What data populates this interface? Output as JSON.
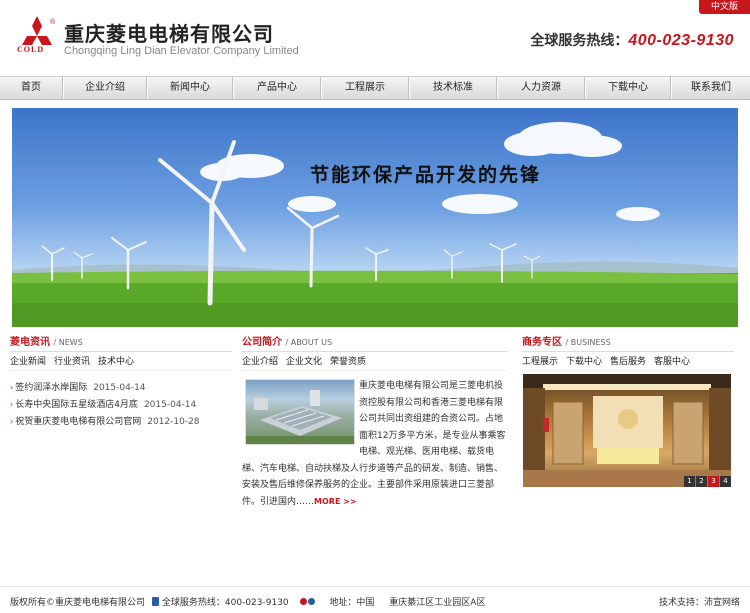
{
  "header": {
    "lang_badge": "中文版",
    "logo_word": "COLD",
    "company_cn": "重庆菱电电梯有限公司",
    "company_en": "Chongqing Ling Dian Elevator Company Limited",
    "hotline_label": "全球服务热线：",
    "hotline_number": "400-023-9130"
  },
  "nav": {
    "items": [
      "首页",
      "企业介绍",
      "新闻中心",
      "产品中心",
      "工程展示",
      "技术标准",
      "人力资源",
      "下载中心",
      "联系我们"
    ]
  },
  "banner": {
    "slogan": "节能环保产品开发的先锋"
  },
  "news": {
    "title": "菱电资讯",
    "subtitle": "/ NEWS",
    "tabs": [
      "企业新闻",
      "行业资讯",
      "技术中心"
    ],
    "items": [
      {
        "title": "签约润泽水岸国际",
        "date": "2015-04-14"
      },
      {
        "title": "长寿中央国际五星级酒店4月底",
        "date": "2015-04-14"
      },
      {
        "title": "祝贺重庆菱电电梯有限公司官网",
        "date": "2012-10-28"
      }
    ]
  },
  "about": {
    "title": "公司简介",
    "subtitle": "/ ABOUT US",
    "tabs": [
      "企业介绍",
      "企业文化",
      "荣誉资质"
    ],
    "text": "重庆菱电电梯有限公司是三菱电机投资控股有限公司和香港三菱电梯有限公司共同出资组建的合资公司。占地面积12万多平方米，是专业从事乘客电梯、观光梯、医用电梯、载货电梯、汽车电梯、自动扶梯及人行步道等产品的研发、制造、销售、安装及售后维修保养服务的企业。主要部件采用原装进口三菱部件。引进国内……",
    "more": "MORE >>"
  },
  "business": {
    "title": "商务专区",
    "subtitle": "/ BUSINESS",
    "tabs": [
      "工程展示",
      "下载中心",
      "售后服务",
      "客服中心"
    ],
    "slides": [
      "1",
      "2",
      "3",
      "4"
    ],
    "active_slide": 3
  },
  "footer": {
    "copyright": "版权所有©重庆菱电电梯有限公司",
    "hotline": "全球服务热线：400-023-9130",
    "address_label": "地址：中国",
    "address": "重庆綦江区工业园区A区",
    "support": "技术支持：沛宣网络"
  },
  "colors": {
    "brand_red": "#c8161d",
    "nav_bg": "#e2e2e2"
  }
}
